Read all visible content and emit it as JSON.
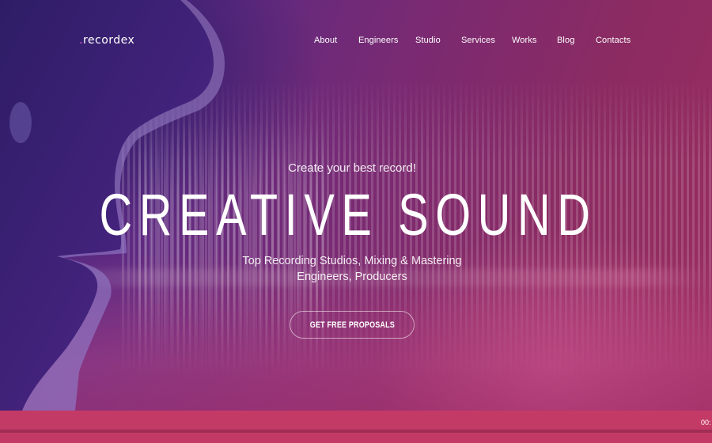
{
  "brand": {
    "logo_dot": ".",
    "logo_text": "recordex",
    "accent_color": "#d45fd8"
  },
  "nav": {
    "items": [
      {
        "label": "About"
      },
      {
        "label": "Engineers"
      },
      {
        "label": "Studio"
      },
      {
        "label": "Services"
      },
      {
        "label": "Works"
      },
      {
        "label": "Blog"
      },
      {
        "label": "Contacts"
      }
    ]
  },
  "hero": {
    "tagline": "Create your best record!",
    "headline": "CREATIVE SOUND",
    "subtitle_line1": "Top Recording Studios, Mixing & Mastering",
    "subtitle_line2": "Engineers, Producers",
    "cta_label": "GET FREE PROPOSALS",
    "background_image": "face-profile-silhouette-with-sound-waves",
    "gradient_colors": [
      "#3d2477",
      "#7a2a72",
      "#9b2d5f"
    ]
  },
  "player": {
    "time_text": "00:",
    "bar_color": "#c43a66"
  }
}
